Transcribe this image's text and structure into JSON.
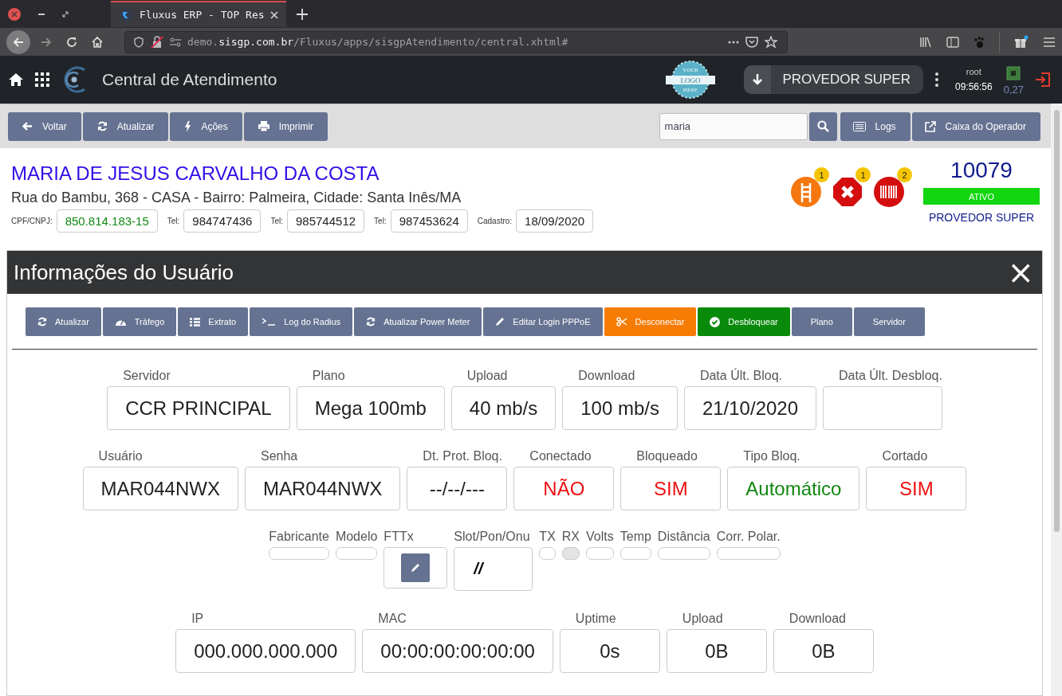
{
  "browser": {
    "tab_title": "Fluxus ERP - TOP Res",
    "url": {
      "subdomain": "demo.",
      "domain": "sisgp.com.br",
      "path": "/Fluxus/apps/sisgpAtendimento/central.xhtml#"
    }
  },
  "header": {
    "title": "Central de Atendimento",
    "logo_text": [
      "YOUR",
      "LOGO",
      "HERE"
    ],
    "provider": "PROVEDOR SUPER",
    "user": "root",
    "time": "09:56:56",
    "cpu": "0,27"
  },
  "toolbar": {
    "buttons": [
      "Voltar",
      "Atualizar",
      "Ações",
      "Imprimir"
    ],
    "search": {
      "value": "maria"
    },
    "right_buttons": [
      "Logs",
      "Caixa do Operador"
    ]
  },
  "customer": {
    "name": "MARIA DE JESUS CARVALHO DA COSTA",
    "address": "Rua do Bambu, 368 - CASA - Bairro: Palmeira, Cidade: Santa Inês/MA",
    "fields": [
      {
        "label": "CPF/CNPJ:",
        "value": "850.814.183-15",
        "color": "#118811"
      },
      {
        "label": "Tel:",
        "value": "984747436"
      },
      {
        "label": "Tel:",
        "value": "985744512"
      },
      {
        "label": "Tel:",
        "value": "987453624"
      },
      {
        "label": "Cadastro:",
        "value": "18/09/2020"
      }
    ],
    "alerts": [
      {
        "count": "1",
        "color": "#f5770f"
      },
      {
        "count": "1",
        "color": "#d40e0e"
      },
      {
        "count": "2",
        "color": "#d40e0e"
      }
    ],
    "code": "10079",
    "status": "ATIVO",
    "provider": "PROVEDOR SUPER"
  },
  "panel": {
    "title": "Informações do Usuário",
    "close": "×",
    "actions": [
      {
        "label": "Atualizar",
        "color": "#657291"
      },
      {
        "label": "Tráfego",
        "color": "#657291"
      },
      {
        "label": "Extrato",
        "color": "#657291"
      },
      {
        "label": "Log do Radius",
        "color": "#657291"
      },
      {
        "label": "Atualizar Power Meter",
        "color": "#657291"
      },
      {
        "label": "Editar Login PPPoE",
        "color": "#657291"
      },
      {
        "label": "Desconectar",
        "color": "#f77c06"
      },
      {
        "label": "Desbloquear",
        "color": "#0a8a0a"
      },
      {
        "label": "Plano",
        "color": "#657291"
      },
      {
        "label": "Servidor",
        "color": "#657291"
      }
    ],
    "rows": [
      {
        "fields": [
          {
            "kind": "large",
            "label": "Servidor",
            "value": "CCR PRINCIPAL"
          },
          {
            "kind": "large",
            "label": "Plano",
            "value": "Mega 100mb"
          },
          {
            "kind": "large",
            "label": "Upload",
            "value": "40 mb/s"
          },
          {
            "kind": "large",
            "label": "Download",
            "value": "100 mb/s"
          },
          {
            "kind": "large",
            "label": "Data Últ. Bloq.",
            "value": "21/10/2020"
          },
          {
            "kind": "large",
            "label": "Data Últ. Desbloq."
          }
        ]
      },
      {
        "fields": [
          {
            "kind": "large",
            "label": "Usuário",
            "value": "MAR044NWX"
          },
          {
            "kind": "large",
            "label": "Senha",
            "value": "MAR044NWX"
          },
          {
            "kind": "large",
            "label": "Dt. Prot. Bloq.",
            "value": "--/--/---"
          },
          {
            "kind": "large",
            "label": "Conectado",
            "value": "NÃO",
            "color": "#ee1111"
          },
          {
            "kind": "large",
            "label": "Bloqueado",
            "value": "SIM",
            "color": "#ee1111"
          },
          {
            "kind": "large",
            "label": "Tipo Bloq.",
            "value": "Automático",
            "color": "#118811"
          },
          {
            "kind": "large",
            "label": "Cortado",
            "value": "SIM",
            "color": "#ee1111"
          }
        ]
      },
      {
        "fields": [
          {
            "kind": "small",
            "label": "Fabricante"
          },
          {
            "kind": "small",
            "label": "Modelo"
          },
          {
            "kind": "edit",
            "label": "FTTx"
          },
          {
            "kind": "tall",
            "label": "Slot/Pon/Onu",
            "value": "//"
          },
          {
            "kind": "small",
            "label": "TX"
          },
          {
            "kind": "small",
            "label": "RX",
            "disabled": true
          },
          {
            "kind": "small",
            "label": "Volts"
          },
          {
            "kind": "small",
            "label": "Temp"
          },
          {
            "kind": "small",
            "label": "Distância"
          },
          {
            "kind": "small",
            "label": "Corr. Polar."
          }
        ]
      },
      {
        "fields": [
          {
            "kind": "large",
            "label": "IP",
            "value": "000.000.000.000"
          },
          {
            "kind": "large",
            "label": "MAC",
            "value": "00:00:00:00:00:00"
          },
          {
            "kind": "large",
            "label": "Uptime",
            "value": "0s"
          },
          {
            "kind": "large",
            "label": "Upload",
            "value": "0B"
          },
          {
            "kind": "large",
            "label": "Download",
            "value": "0B"
          }
        ]
      }
    ]
  }
}
